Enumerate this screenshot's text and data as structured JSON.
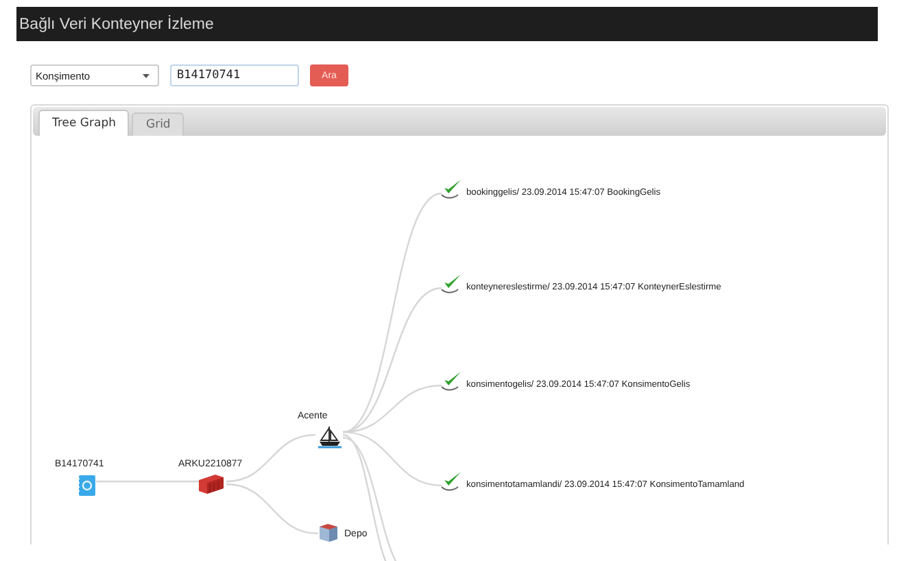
{
  "header": {
    "title": "Bağlı Veri Konteyner İzleme"
  },
  "search": {
    "type_select": "Konşimento",
    "query": "B14170741",
    "button": "Ara"
  },
  "tabs": [
    {
      "label": "Tree Graph",
      "selected": true
    },
    {
      "label": "Grid",
      "selected": false
    }
  ],
  "tree": {
    "label": "B14170741",
    "kind": "document",
    "children": [
      {
        "label": "ARKU2210877",
        "kind": "container",
        "children": [
          {
            "label": "Acente",
            "kind": "ship",
            "children": [
              {
                "label": "bookinggelis/ 23.09.2014 15:47:07 BookingGelis",
                "kind": "check"
              },
              {
                "label": "konteynereslestirme/ 23.09.2014 15:47:07 KonteynerEslestirme",
                "kind": "check"
              },
              {
                "label": "konsimentogelis/ 23.09.2014 15:47:07 KonsimentoGelis",
                "kind": "check"
              },
              {
                "label": "konsimentotamamlandi/ 23.09.2014 15:47:07 KonsimentoTamamland",
                "kind": "check"
              }
            ]
          },
          {
            "label": "Depo",
            "kind": "depot"
          }
        ]
      }
    ]
  }
}
